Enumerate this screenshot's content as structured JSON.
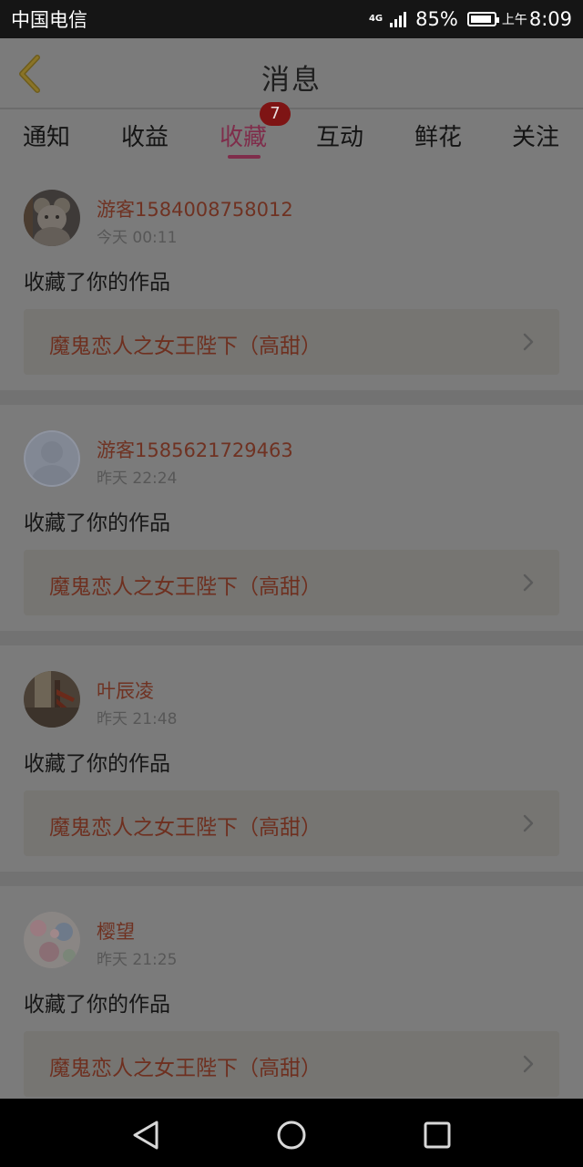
{
  "status_bar": {
    "carrier": "中国电信",
    "network": "4G",
    "battery": "85%",
    "time_prefix": "上午",
    "time": "8:09"
  },
  "header": {
    "title": "消息",
    "back_icon": "chevron-left-icon"
  },
  "tabs": [
    {
      "label": "通知",
      "active": false
    },
    {
      "label": "收益",
      "active": false
    },
    {
      "label": "收藏",
      "active": true,
      "badge": "7"
    },
    {
      "label": "互动",
      "active": false
    },
    {
      "label": "鲜花",
      "active": false
    },
    {
      "label": "关注",
      "active": false
    }
  ],
  "feed": [
    {
      "user": "游客1584008758012",
      "time": "今天 00:11",
      "action": "收藏了你的作品",
      "work": "魔鬼恋人之女王陛下（高甜）",
      "avatar": "bear-avatar"
    },
    {
      "user": "游客1585621729463",
      "time": "昨天 22:24",
      "action": "收藏了你的作品",
      "work": "魔鬼恋人之女王陛下（高甜）",
      "avatar": "default-avatar"
    },
    {
      "user": "叶辰凌",
      "time": "昨天 21:48",
      "action": "收藏了你的作品",
      "work": "魔鬼恋人之女王陛下（高甜）",
      "avatar": "photo-avatar"
    },
    {
      "user": "樱望",
      "time": "昨天 21:25",
      "action": "收藏了你的作品",
      "work": "魔鬼恋人之女王陛下（高甜）",
      "avatar": "floral-avatar"
    }
  ],
  "colors": {
    "accent": "#7f2d4b",
    "badge": "#7e1414",
    "name_text": "#6f3222",
    "overlay_bg": "#7b7b7b"
  },
  "nav_bar": {
    "icons": [
      "back-triangle-icon",
      "home-circle-icon",
      "recent-square-icon"
    ]
  }
}
